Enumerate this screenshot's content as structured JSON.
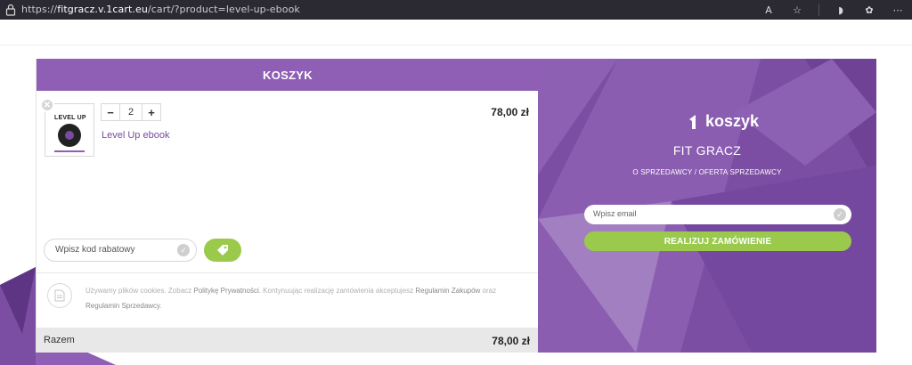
{
  "browser": {
    "url_prefix": "https://",
    "url_host": "fitgracz.v.1cart.eu",
    "url_path": "/cart/?product=level-up-ebook"
  },
  "cart": {
    "header": "KOSZYK",
    "item": {
      "cover_title": "LEVEL UP",
      "quantity": "2",
      "name": "Level Up ebook",
      "price": "78,00 zł",
      "minus": "−",
      "plus": "+"
    },
    "coupon_placeholder": "Wpisz kod rabatowy",
    "notice": {
      "t1": "Używamy plików cookies. Zobacz ",
      "l1": "Politykę Prywatności",
      "t2": ". Kontynuując realizację zamówienia akceptujesz ",
      "l2": "Regulamin Zakupów",
      "t3": " oraz ",
      "l3": "Regulamin Sprzedawcy",
      "t4": "."
    },
    "total_label": "Razem",
    "total_value": "78,00 zł"
  },
  "panel": {
    "logo_text": "koszyk",
    "shop_name": "FIT GRACZ",
    "seller_link": "O SPRZEDAWCY",
    "separator": "/",
    "offer_link": "OFERTA SPRZEDAWCY",
    "email_placeholder": "Wpisz email",
    "order_button": "REALIZUJ ZAMÓWIENIE"
  },
  "colors": {
    "purple": "#8e5fb5",
    "panel_purple": "#7c4ea3",
    "green": "#9ac94c"
  }
}
